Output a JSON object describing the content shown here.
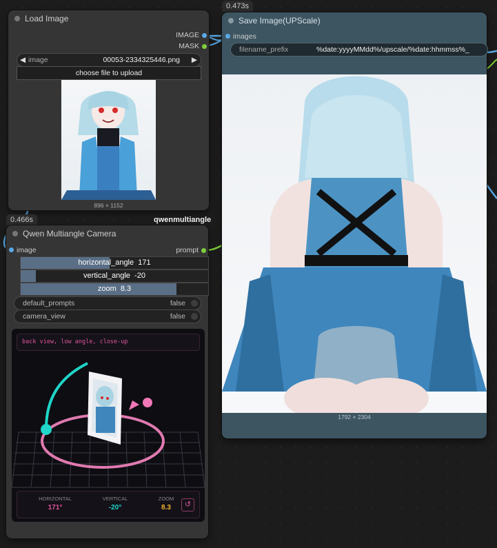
{
  "load_image": {
    "title": "Load Image",
    "outputs": [
      "IMAGE",
      "MASK"
    ],
    "image_label": "image",
    "image_value": "00053-2334325446.png",
    "upload_label": "choose file to upload",
    "size_label": "896 × 1152"
  },
  "save_image": {
    "time": "0.473s",
    "title": "Save Image(UPScale)",
    "input_label": "images",
    "prefix_label": "filename_prefix",
    "prefix_value": "%date:yyyyMMdd%/upscale/%date:hhmmss%_",
    "size_label": "1792 × 2304"
  },
  "qwen": {
    "time": "0.466s",
    "group_label": "qwenmultiangle",
    "title": "Qwen Multiangle Camera",
    "input_label": "image",
    "output_label": "prompt",
    "sliders": [
      {
        "label": "horizontal_angle",
        "value": "171",
        "fraction": 0.475
      },
      {
        "label": "vertical_angle",
        "value": "-20",
        "fraction": 0.08
      },
      {
        "label": "zoom",
        "value": "8.3",
        "fraction": 0.83
      }
    ],
    "toggles": [
      {
        "label": "default_prompts",
        "value": "false"
      },
      {
        "label": "camera_view",
        "value": "false"
      }
    ],
    "prompt_text": "back view, low angle, close-up",
    "readout": {
      "horizontal_label": "HORIZONTAL",
      "horizontal_value": "171°",
      "vertical_label": "VERTICAL",
      "vertical_value": "-20°",
      "zoom_label": "ZOOM",
      "zoom_value": "8.3"
    }
  },
  "colors": {
    "image_link": "#5aa9e6",
    "prompt_link": "#7fcf3a",
    "accent_pink": "#e0559a",
    "accent_cyan": "#1fd6c8",
    "accent_yellow": "#f0b530"
  }
}
